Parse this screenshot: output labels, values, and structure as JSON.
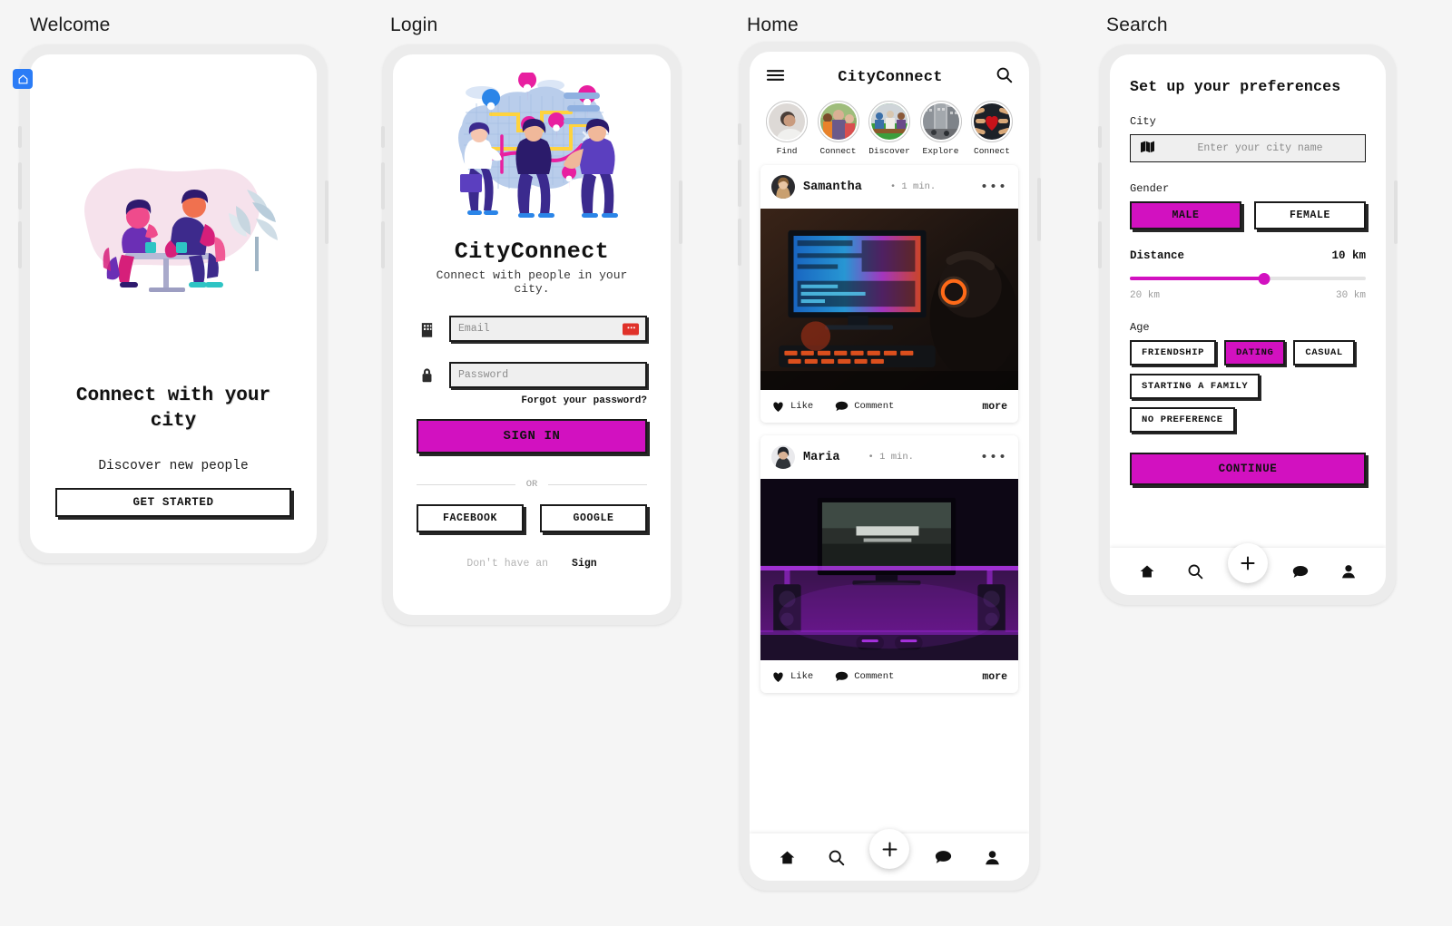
{
  "screens": {
    "welcome": {
      "title": "Welcome"
    },
    "login": {
      "title": "Login"
    },
    "home": {
      "title": "Home"
    },
    "search": {
      "title": "Search"
    }
  },
  "colors": {
    "accent": "#d211c0",
    "ink": "#1a1a1a",
    "page_bg": "#f5f5f5",
    "badge_blue": "#2b7cf6",
    "badge_red": "#e03129"
  },
  "welcome": {
    "home_badge_icon": "home-icon",
    "illustration": "two-people-at-cafe-table-illustration",
    "heading": "Connect with your city",
    "subheading": "Discover new people",
    "cta_label": "GET STARTED"
  },
  "login": {
    "illustration": "city-map-with-people-illustration",
    "app_name": "CityConnect",
    "tagline": "Connect with people in your city.",
    "email": {
      "icon": "building-icon",
      "placeholder": "Email",
      "value": "",
      "badge": "suggestion-badge"
    },
    "password": {
      "icon": "lock-icon",
      "placeholder": "Password",
      "value": ""
    },
    "forgot_label": "Forgot your password?",
    "signin_label": "SIGN IN",
    "divider_label": "OR",
    "facebook_label": "FACEBOOK",
    "google_label": "GOOGLE",
    "footer_muted": "Don't have an",
    "footer_link": "Sign"
  },
  "home": {
    "menu_icon": "hamburger-menu-icon",
    "app_name": "CityConnect",
    "search_icon": "search-icon",
    "stories": [
      {
        "label": "Find",
        "thumb": "man-portrait-grey"
      },
      {
        "label": "Connect",
        "thumb": "group-of-friends-outdoors"
      },
      {
        "label": "Discover",
        "thumb": "people-at-dinner-table"
      },
      {
        "label": "Explore",
        "thumb": "city-street-scene"
      },
      {
        "label": "Connect",
        "thumb": "hands-holding-red-heart"
      }
    ],
    "posts": [
      {
        "author": "Samantha",
        "avatar": "woman-blonde-avatar",
        "time": "• 1 min.",
        "menu_icon": "more-options-icon",
        "image": "gaming-setup-with-headset-and-monitor",
        "like_label": "Like",
        "comment_label": "Comment",
        "more_label": "more"
      },
      {
        "author": "Maria",
        "avatar": "woman-dark-hair-avatar",
        "time": "• 1 min.",
        "menu_icon": "more-options-icon",
        "image": "living-room-tv-warzone-purple-lights",
        "like_label": "Like",
        "comment_label": "Comment",
        "more_label": "more"
      }
    ],
    "tabbar": [
      {
        "icon": "home-icon",
        "name": "tab-home"
      },
      {
        "icon": "search-icon",
        "name": "tab-search"
      },
      {
        "icon": "plus-icon",
        "name": "tab-create"
      },
      {
        "icon": "chat-bubble-icon",
        "name": "tab-messages"
      },
      {
        "icon": "person-icon",
        "name": "tab-profile"
      }
    ]
  },
  "search": {
    "heading": "Set up your preferences",
    "city_label": "City",
    "city_icon": "map-icon",
    "city_placeholder": "Enter your city name",
    "city_value": "",
    "gender_label": "Gender",
    "gender_options": [
      {
        "label": "MALE",
        "selected": true
      },
      {
        "label": "FEMALE",
        "selected": false
      }
    ],
    "distance_label": "Distance",
    "distance_value": "10 km",
    "distance_min": "20 km",
    "distance_max": "30 km",
    "distance_percent": 57,
    "age_label": "Age",
    "age_options": [
      {
        "label": "FRIENDSHIP",
        "selected": false
      },
      {
        "label": "DATING",
        "selected": true
      },
      {
        "label": "CASUAL",
        "selected": false
      },
      {
        "label": "STARTING A FAMILY",
        "selected": false
      },
      {
        "label": "NO PREFERENCE",
        "selected": false
      }
    ],
    "continue_label": "CONTINUE",
    "tabbar": [
      {
        "icon": "home-icon",
        "name": "tab-home"
      },
      {
        "icon": "search-icon",
        "name": "tab-search"
      },
      {
        "icon": "plus-icon",
        "name": "tab-create"
      },
      {
        "icon": "chat-bubble-icon",
        "name": "tab-messages"
      },
      {
        "icon": "person-icon",
        "name": "tab-profile"
      }
    ]
  }
}
